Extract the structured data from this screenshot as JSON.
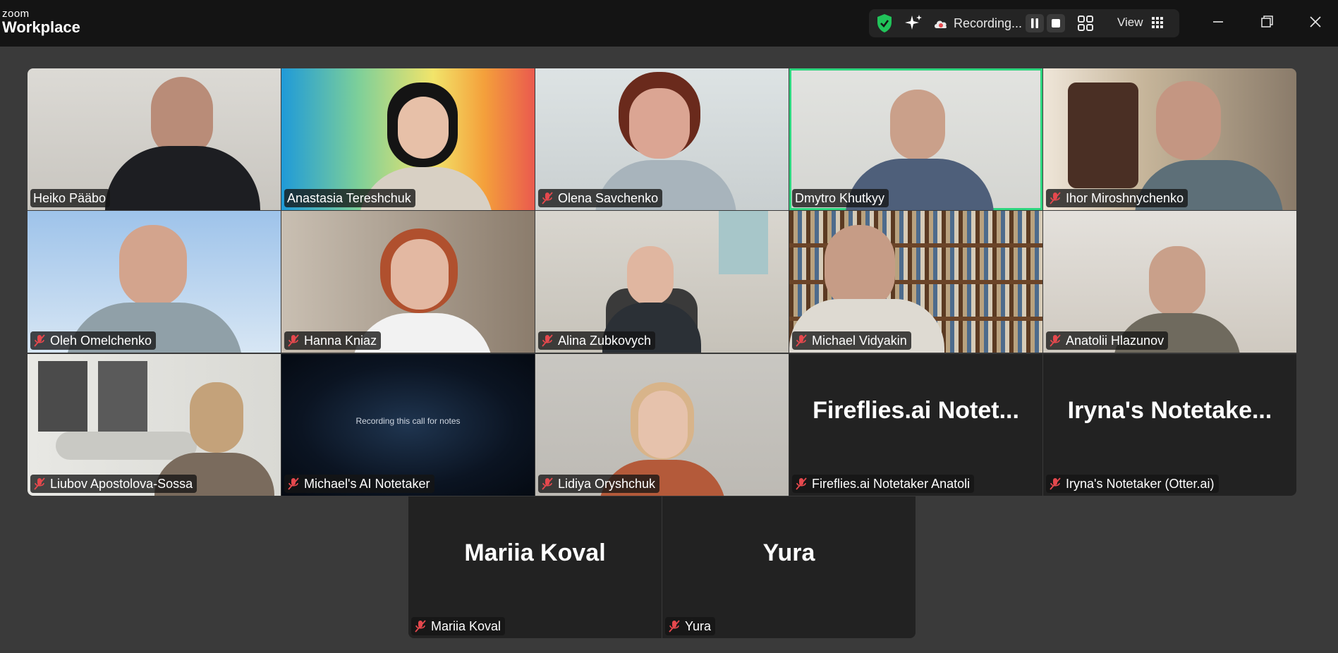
{
  "app": {
    "logo_small": "zoom",
    "logo_big": "Workplace"
  },
  "toolbar": {
    "recording_label": "Recording...",
    "view_label": "View",
    "icons": [
      "shield-check-icon",
      "ai-sparkle-icon",
      "cloud-record-icon",
      "pause-icon",
      "stop-icon",
      "gallery-layout-icon",
      "grid-icon",
      "minimize-icon",
      "restore-icon",
      "close-icon"
    ]
  },
  "colors": {
    "active_speaker": "#2ed67f",
    "mute_icon": "#e5484d",
    "shield": "#21c35a"
  },
  "participants": [
    {
      "name": "Heiko Pääbo",
      "muted": false
    },
    {
      "name": "Anastasia Tereshchuk",
      "muted": false
    },
    {
      "name": "Olena Savchenko",
      "muted": true
    },
    {
      "name": "Dmytro Khutkyy",
      "muted": false,
      "active": true
    },
    {
      "name": "Ihor Miroshnychenko",
      "muted": true
    },
    {
      "name": "Oleh Omelchenko",
      "muted": true
    },
    {
      "name": "Hanna Kniaz",
      "muted": true
    },
    {
      "name": "Alina Zubkovych",
      "muted": true
    },
    {
      "name": "Michael Vidyakin",
      "muted": true
    },
    {
      "name": "Anatolii Hlazunov",
      "muted": true
    },
    {
      "name": "Liubov Apostolova-Sossa",
      "muted": true
    },
    {
      "name": "Michael's AI Notetaker",
      "muted": true,
      "screen_text": "Recording this call for notes"
    },
    {
      "name": "Lidiya Oryshchuk",
      "muted": true
    },
    {
      "name": "Fireflies.ai Notetaker Anatoli",
      "muted": true,
      "big_name": "Fireflies.ai  Notet..."
    },
    {
      "name": "Iryna's Notetaker (Otter.ai)",
      "muted": true,
      "big_name": "Iryna's  Notetake..."
    },
    {
      "name": "Mariia Koval",
      "muted": true,
      "big_name": "Mariia Koval"
    },
    {
      "name": "Yura",
      "muted": true,
      "big_name": "Yura"
    }
  ]
}
